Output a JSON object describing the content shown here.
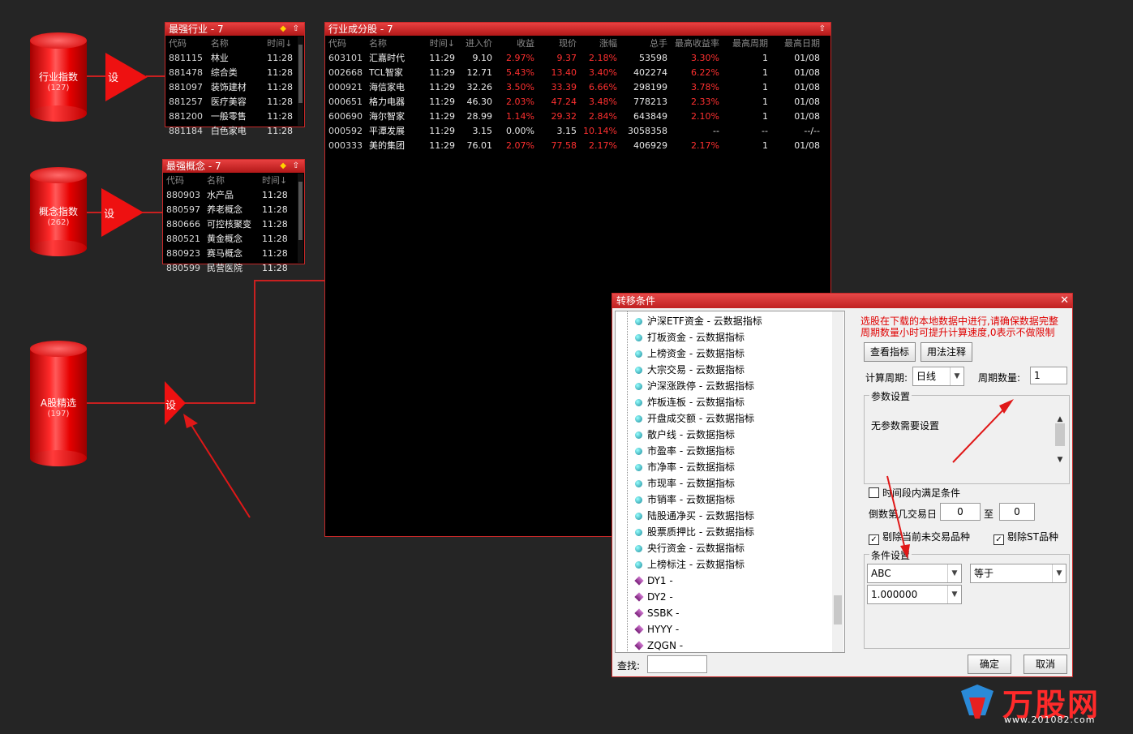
{
  "colors": {
    "accent_red": "#e81c1c",
    "panel_bg": "#000000",
    "pct_red": "#ff3030"
  },
  "nodes": [
    {
      "label": "行业指数",
      "count": "(127)"
    },
    {
      "label": "概念指数",
      "count": "(262)"
    },
    {
      "label": "A股精选",
      "count": "(197)"
    }
  ],
  "set_label": "设",
  "panel_industry": {
    "title": "最强行业 - 7",
    "headers": [
      "代码",
      "名称",
      "时间↓"
    ],
    "rows": [
      [
        "881115",
        "林业",
        "11:28"
      ],
      [
        "881478",
        "综合类",
        "11:28"
      ],
      [
        "881097",
        "装饰建材",
        "11:28"
      ],
      [
        "881257",
        "医疗美容",
        "11:28"
      ],
      [
        "881200",
        "一般零售",
        "11:28"
      ],
      [
        "881184",
        "白色家电",
        "11:28"
      ]
    ]
  },
  "panel_concept": {
    "title": "最强概念 - 7",
    "headers": [
      "代码",
      "名称",
      "时间↓"
    ],
    "rows": [
      [
        "880903",
        "水产品",
        "11:28"
      ],
      [
        "880597",
        "养老概念",
        "11:28"
      ],
      [
        "880666",
        "可控核聚变",
        "11:28"
      ],
      [
        "880521",
        "黄金概念",
        "11:28"
      ],
      [
        "880923",
        "赛马概念",
        "11:28"
      ],
      [
        "880599",
        "民营医院",
        "11:28"
      ]
    ]
  },
  "panel_stocks": {
    "title": "行业成分股 - 7",
    "headers": [
      "代码",
      "名称",
      "时间↓",
      "进入价",
      "收益",
      "现价",
      "涨幅",
      "总手",
      "最高收益率",
      "最高周期",
      "最高日期"
    ],
    "rows": [
      [
        "603101",
        "汇嘉时代",
        "11:29",
        "9.10",
        "2.97%",
        "9.37",
        "2.18%",
        "53598",
        "3.30%",
        "1",
        "01/08"
      ],
      [
        "002668",
        "TCL智家",
        "11:29",
        "12.71",
        "5.43%",
        "13.40",
        "3.40%",
        "402274",
        "6.22%",
        "1",
        "01/08"
      ],
      [
        "000921",
        "海信家电",
        "11:29",
        "32.26",
        "3.50%",
        "33.39",
        "6.66%",
        "298199",
        "3.78%",
        "1",
        "01/08"
      ],
      [
        "000651",
        "格力电器",
        "11:29",
        "46.30",
        "2.03%",
        "47.24",
        "3.48%",
        "778213",
        "2.33%",
        "1",
        "01/08"
      ],
      [
        "600690",
        "海尔智家",
        "11:29",
        "28.99",
        "1.14%",
        "29.32",
        "2.84%",
        "643849",
        "2.10%",
        "1",
        "01/08"
      ],
      [
        "000592",
        "平潭发展",
        "11:29",
        "3.15",
        "0.00%",
        "3.15",
        "10.14%",
        "3058358",
        "--",
        "--",
        "--/--"
      ],
      [
        "000333",
        "美的集团",
        "11:29",
        "76.01",
        "2.07%",
        "77.58",
        "2.17%",
        "406929",
        "2.17%",
        "1",
        "01/08"
      ]
    ]
  },
  "dialog": {
    "title": "转移条件",
    "close": "✕",
    "tree_items": [
      "沪深ETF资金 - 云数据指标",
      "打板资金 - 云数据指标",
      "上榜资金 - 云数据指标",
      "大宗交易 - 云数据指标",
      "沪深涨跌停 - 云数据指标",
      "炸板连板 - 云数据指标",
      "开盘成交额 - 云数据指标",
      "散户线 - 云数据指标",
      "市盈率 - 云数据指标",
      "市净率 - 云数据指标",
      "市现率 - 云数据指标",
      "市销率 - 云数据指标",
      "陆股通净买 - 云数据指标",
      "股票质押比 - 云数据指标",
      "央行资金 - 云数据指标",
      "上榜标注 - 云数据指标"
    ],
    "formula_items": [
      "DY1 -",
      "DY2 -",
      "SSBK -",
      "HYYY -",
      "ZQGN -"
    ],
    "search_label": "查找:",
    "search_value": "",
    "notice_line1": "选股在下载的本地数据中进行,请确保数据完整",
    "notice_line2": "周期数量小时可提升计算速度,0表示不做限制",
    "btn_view": "查看指标",
    "btn_usage": "用法注释",
    "period_label": "计算周期:",
    "period_value": "日线",
    "count_label": "周期数量:",
    "count_value": "1",
    "param_group": "参数设置",
    "param_text": "无参数需要设置",
    "range_check": "时间段内满足条件",
    "range_label": "倒数第几交易日",
    "range_from": "0",
    "range_to_label": "至",
    "range_to": "0",
    "exclude_untraded": "剔除当前未交易品种",
    "exclude_st": "剔除ST品种",
    "cond_group": "条件设置",
    "cond_var": "ABC",
    "cond_op": "等于",
    "cond_value": "1.000000",
    "btn_ok": "确定",
    "btn_cancel": "取消"
  },
  "watermark": {
    "brand": "万股网",
    "url": "www.201082.com"
  }
}
